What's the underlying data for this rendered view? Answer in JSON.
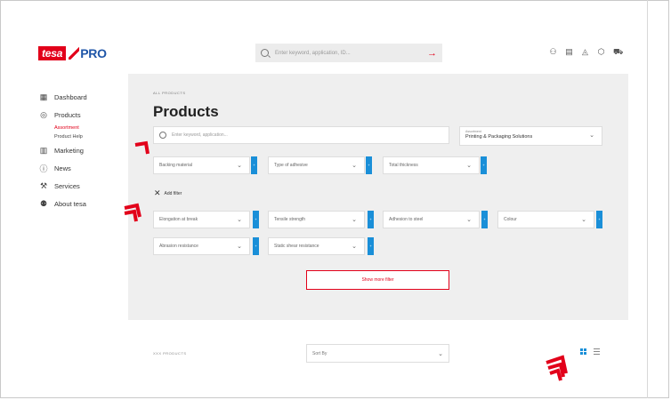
{
  "brand": {
    "tesa": "tesa",
    "pro": "PRO"
  },
  "header": {
    "search_placeholder": "Enter keyword, application, ID...",
    "icons": [
      "user-icon",
      "document-icon",
      "bell-icon",
      "box-icon",
      "cart-icon"
    ]
  },
  "sidebar": {
    "items": [
      {
        "label": "Dashboard",
        "icon": "dashboard-icon"
      },
      {
        "label": "Products",
        "icon": "products-icon"
      },
      {
        "label": "Marketing",
        "icon": "marketing-icon"
      },
      {
        "label": "News",
        "icon": "news-icon"
      },
      {
        "label": "Services",
        "icon": "services-icon"
      },
      {
        "label": "About tesa",
        "icon": "about-icon"
      }
    ],
    "sub_items": [
      {
        "label": "Assortment",
        "active": true
      },
      {
        "label": "Product Help",
        "active": false
      }
    ]
  },
  "main": {
    "breadcrumb": "ALL PRODUCTS",
    "title": "Products",
    "search_placeholder": "Enter keyword, application...",
    "assortment": {
      "label": "Assortment",
      "value": "Printing & Packaging Solutions"
    },
    "filters_row1": [
      "Backing material",
      "Type of adhesive",
      "Total thickness"
    ],
    "add_filter": "Add filter",
    "filters_row2": [
      "Elongation at break",
      "Tensile strength",
      "Adhesion to steel",
      "Colour"
    ],
    "filters_row3": [
      "Abrasion resistance",
      "Static shear resistance"
    ],
    "show_more": "Show more filter",
    "count": "XXX PRODUCTS",
    "sort": "Sort By"
  },
  "colors": {
    "accent": "#e2001a",
    "blue": "#1a8fd8",
    "panel": "#efefef"
  }
}
